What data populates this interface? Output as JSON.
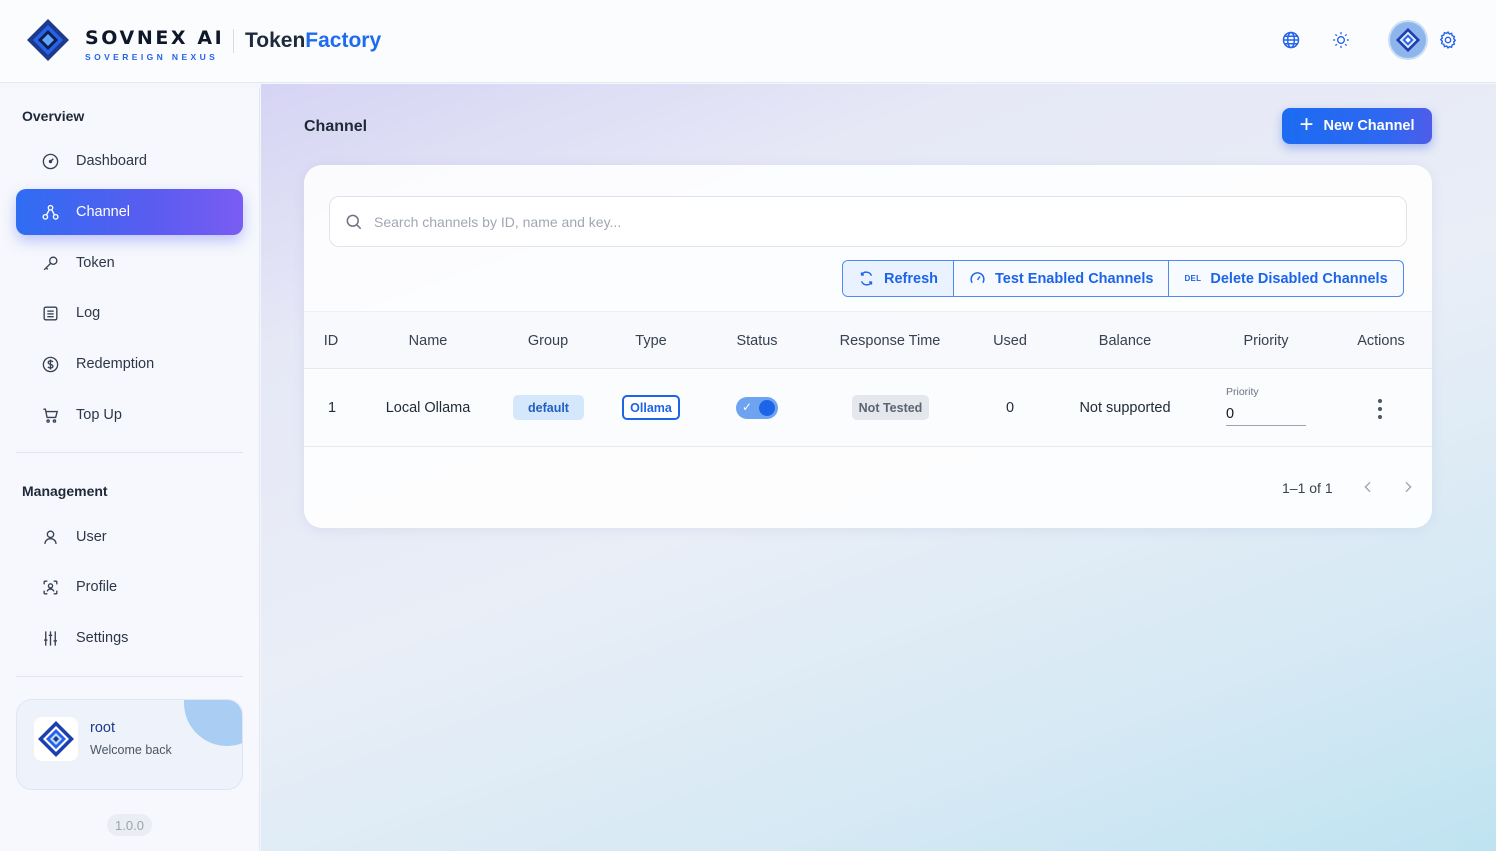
{
  "header": {
    "brand_name": "SOVNEX AI",
    "brand_sub": "SOVEREIGN NEXUS",
    "app_title_part1": "Token",
    "app_title_part2": "Factory",
    "icons": [
      "globe-icon",
      "sun-icon",
      "avatar",
      "gear-icon"
    ]
  },
  "sidebar": {
    "overview_label": "Overview",
    "management_label": "Management",
    "overview_items": [
      {
        "label": "Dashboard",
        "icon": "dashboard-icon"
      },
      {
        "label": "Channel",
        "icon": "channel-icon",
        "active": true
      },
      {
        "label": "Token",
        "icon": "key-icon"
      },
      {
        "label": "Log",
        "icon": "log-icon"
      },
      {
        "label": "Redemption",
        "icon": "dollar-icon"
      },
      {
        "label": "Top Up",
        "icon": "cart-icon"
      }
    ],
    "management_items": [
      {
        "label": "User",
        "icon": "user-icon"
      },
      {
        "label": "Profile",
        "icon": "profile-icon"
      },
      {
        "label": "Settings",
        "icon": "sliders-icon"
      }
    ],
    "user": {
      "name": "root",
      "subtitle": "Welcome back"
    },
    "version": "1.0.0"
  },
  "main": {
    "page_title": "Channel",
    "new_button": "New Channel",
    "search_placeholder": "Search channels by ID, name and key...",
    "actions": {
      "refresh": "Refresh",
      "test": "Test Enabled Channels",
      "delete_tag": "DEL",
      "delete": "Delete Disabled Channels"
    },
    "table": {
      "columns": [
        "ID",
        "Name",
        "Group",
        "Type",
        "Status",
        "Response Time",
        "Used",
        "Balance",
        "Priority",
        "Actions"
      ],
      "rows": [
        {
          "id": "1",
          "name": "Local Ollama",
          "group": "default",
          "type": "Ollama",
          "status_enabled": true,
          "response_time": "Not Tested",
          "used": "0",
          "balance": "Not supported",
          "priority_label": "Priority",
          "priority": "0"
        }
      ]
    },
    "pagination": "1–1 of 1"
  },
  "colors": {
    "accent": "#1c64e8",
    "active_gradient_start": "#2f6df2",
    "active_gradient_end": "#7a5cf2"
  }
}
